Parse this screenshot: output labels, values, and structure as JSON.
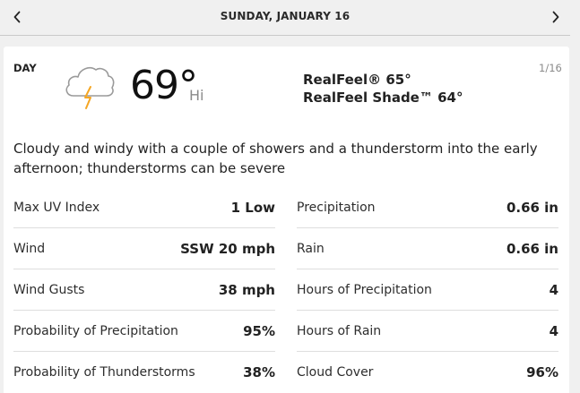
{
  "header": {
    "date": "SUNDAY, JANUARY 16",
    "prev_icon": "chevron-left-icon",
    "next_icon": "chevron-right-icon"
  },
  "forecast": {
    "period": "DAY",
    "date_short": "1/16",
    "weather_icon": "cloud-thunderstorm-icon",
    "temperature": "69°",
    "temperature_suffix": "Hi",
    "realfeel": "RealFeel® 65°",
    "realfeel_shade": "RealFeel Shade™ 64°",
    "phrase": "Cloudy and windy with a couple of showers and a thunderstorm into the early afternoon; thunderstorms can be severe"
  },
  "details_left": [
    {
      "label": "Max UV Index",
      "value": "1 Low"
    },
    {
      "label": "Wind",
      "value": "SSW 20 mph"
    },
    {
      "label": "Wind Gusts",
      "value": "38 mph"
    },
    {
      "label": "Probability of Precipitation",
      "value": "95%"
    },
    {
      "label": "Probability of Thunderstorms",
      "value": "38%"
    }
  ],
  "details_right": [
    {
      "label": "Precipitation",
      "value": "0.66 in"
    },
    {
      "label": "Rain",
      "value": "0.66 in"
    },
    {
      "label": "Hours of Precipitation",
      "value": "4"
    },
    {
      "label": "Hours of Rain",
      "value": "4"
    },
    {
      "label": "Cloud Cover",
      "value": "96%"
    }
  ],
  "colors": {
    "lightning": "#f5a623",
    "cloud_outline": "#9a9a9a",
    "background": "#f0f0f0",
    "card": "#ffffff"
  }
}
